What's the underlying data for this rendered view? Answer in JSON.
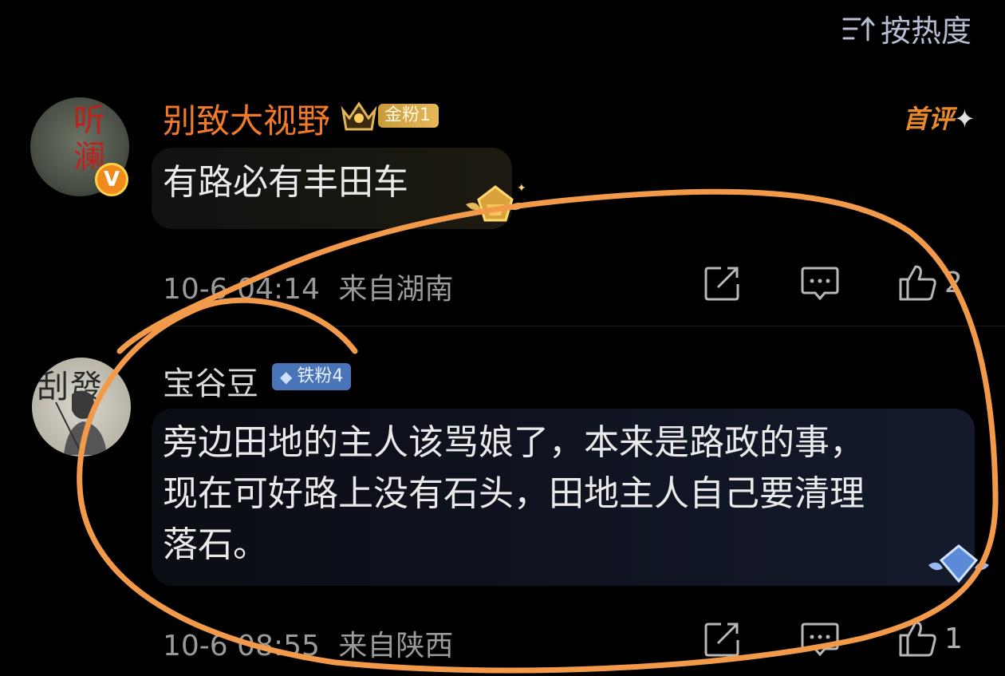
{
  "sort": {
    "label": "按热度",
    "icon": "sort-icon"
  },
  "comments": [
    {
      "username": "别致大视野",
      "fan_badge": "金粉1",
      "first_comment_tag": "首评",
      "avatar_text": "听澜",
      "text": "有路必有丰田车",
      "time": "10-6 04:14",
      "location": "来自湖南",
      "like_count": "2"
    },
    {
      "username": "宝谷豆",
      "fan_badge": "铁粉4",
      "avatar_text": "刮發",
      "text_lines": [
        "旁边田地的主人该骂娘了，本来是路政的事，",
        "现在可好路上没有石头，田地主人自己要清理",
        "落石。"
      ],
      "time": "10-6 08:55",
      "location": "来自陕西",
      "like_count": "1"
    }
  ],
  "colors": {
    "background": "#000000",
    "gold_username": "#f07a2a",
    "annotation_stroke": "#f29a4a",
    "iron_badge": "#4a74b8",
    "gold_badge": "#d6a84a"
  }
}
